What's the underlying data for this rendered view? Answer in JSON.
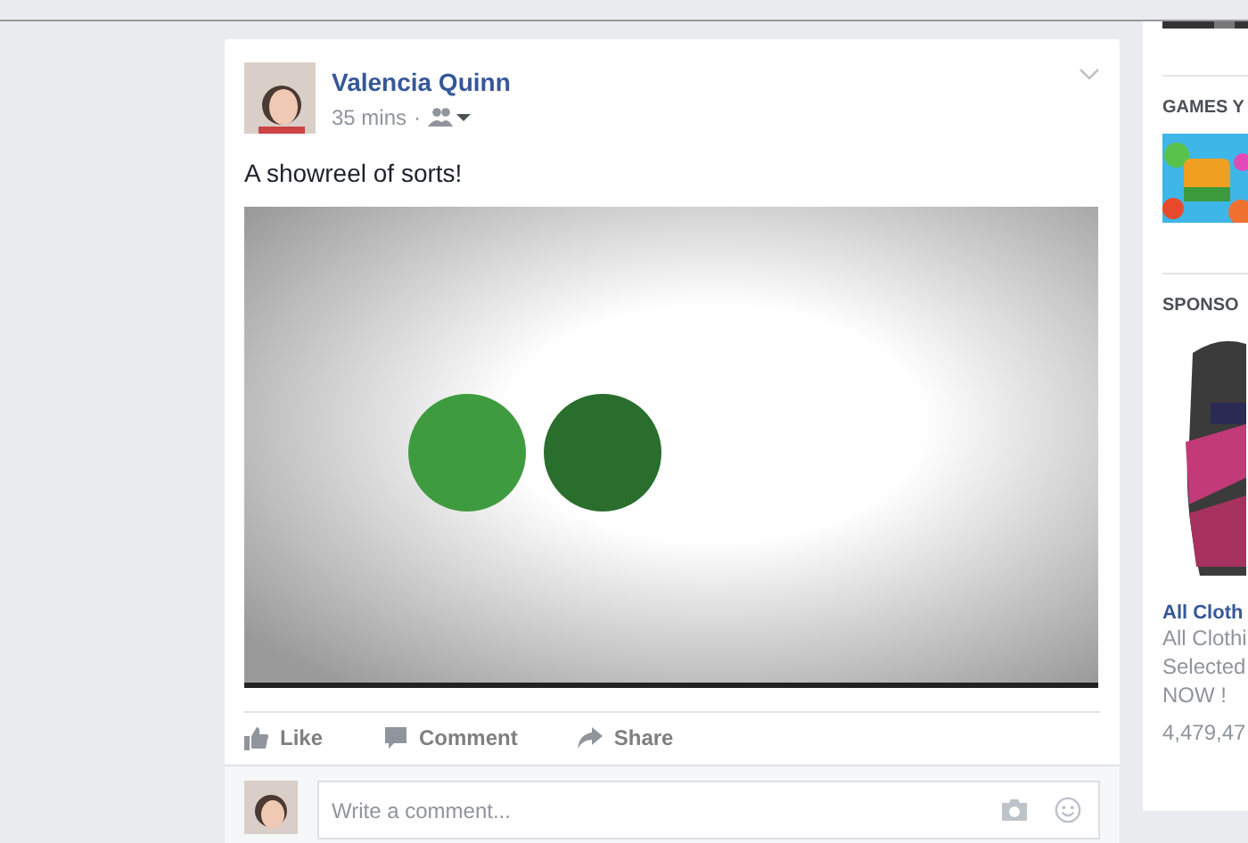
{
  "post": {
    "author": "Valencia Quinn",
    "time": "35 mins",
    "separator": "·",
    "text": "A showreel of sorts!",
    "actions": [
      {
        "kind": "like",
        "label": "Like"
      },
      {
        "kind": "comment",
        "label": "Comment"
      },
      {
        "kind": "share",
        "label": "Share"
      }
    ],
    "comment_field": {
      "placeholder": "Write a comment..."
    }
  },
  "sidebar": {
    "games_heading": "GAMES Y",
    "sponsored_heading": "SPONSO",
    "ad": {
      "title": "All Cloth",
      "lines": [
        "All Clothi",
        "Selected",
        "NOW !"
      ],
      "count": "4,479,47"
    }
  }
}
